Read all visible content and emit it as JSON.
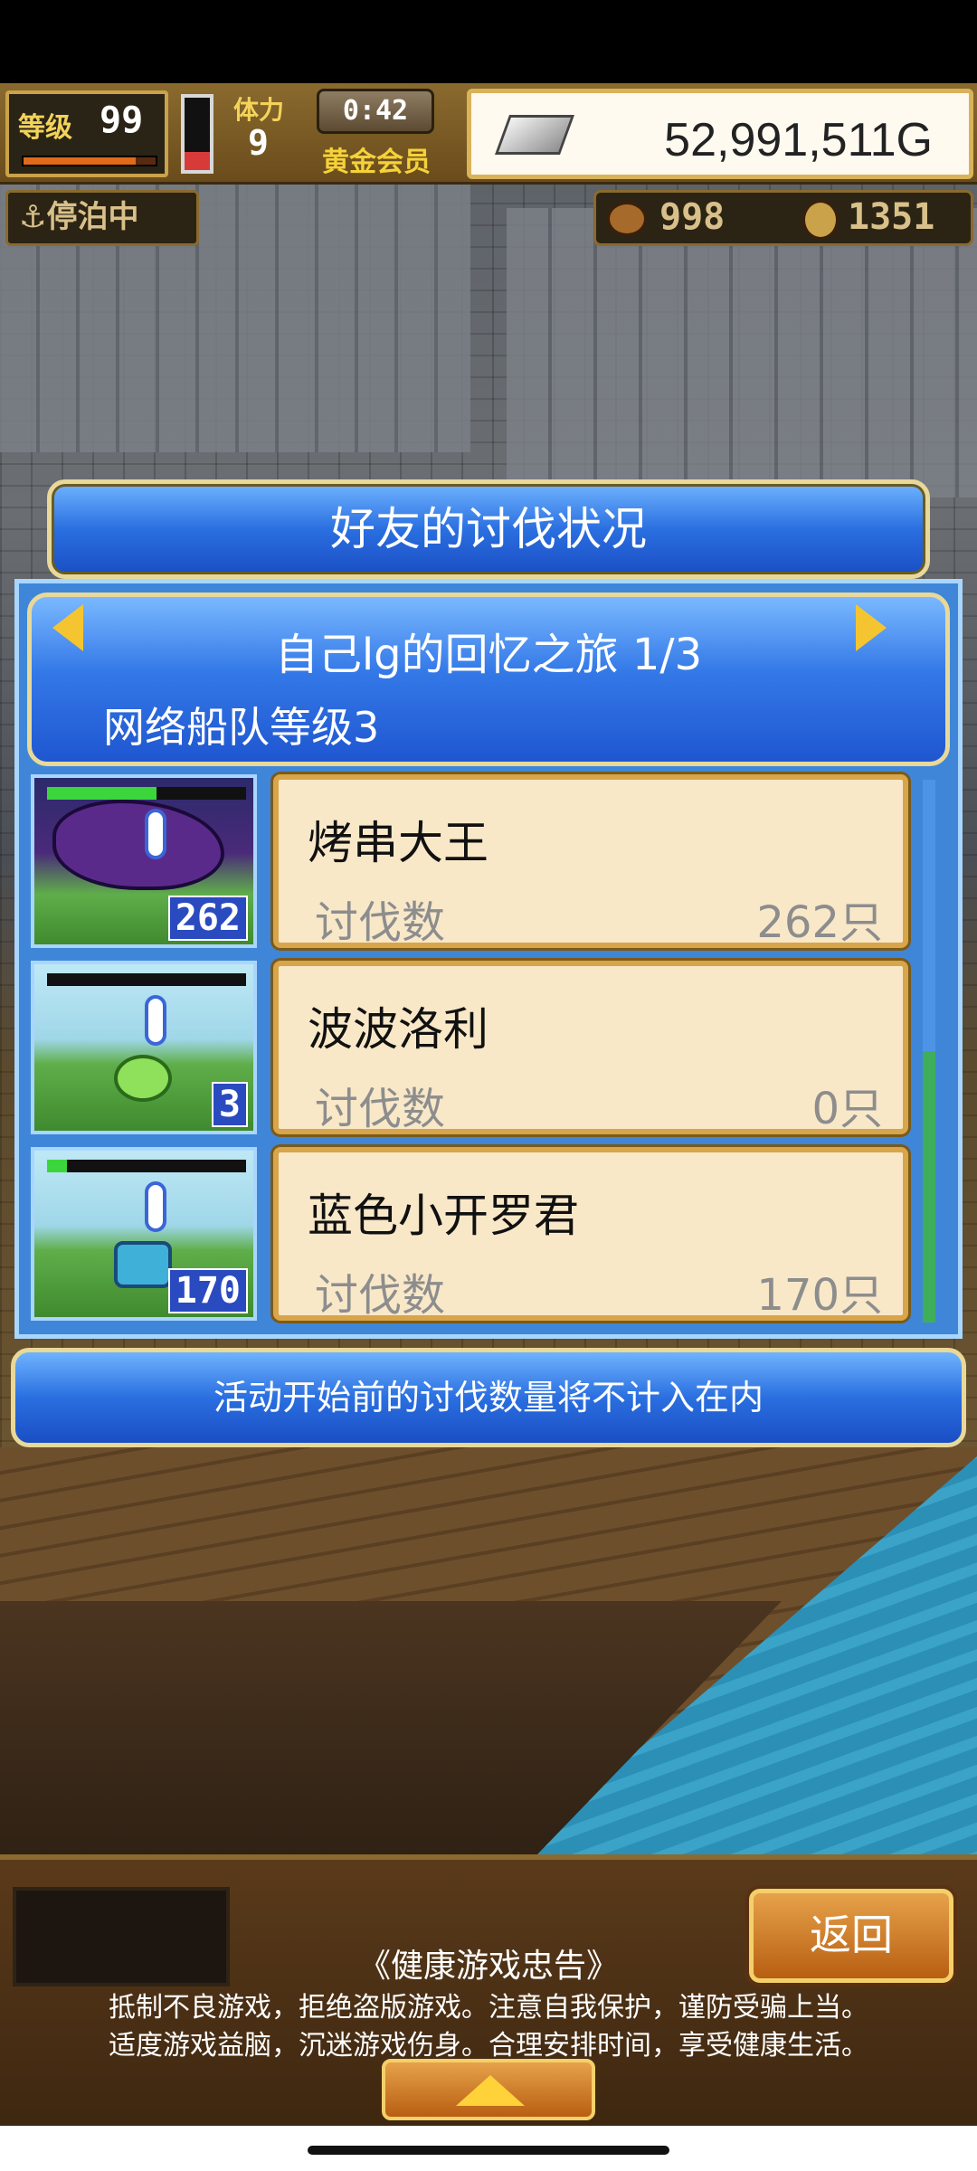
{
  "hud": {
    "level_label": "等级",
    "level_value": "99",
    "level_progress": 0.85,
    "stamina_label": "体力",
    "stamina_value": "9",
    "stamina_fill": 0.25,
    "timer": "0:42",
    "membership": "黄金会员",
    "gold": "52,991,511G",
    "dock_status": "停泊中",
    "resource1": "998",
    "resource2": "1351"
  },
  "dialog": {
    "title": "好友的讨伐状况",
    "event_title": "自己lg的回忆之旅 1/3",
    "event_subtitle": "网络船队等级3",
    "rows": [
      {
        "name": "烤串大王",
        "label": "讨伐数",
        "value": "262只",
        "thumb_count": "262",
        "hp": 0.55
      },
      {
        "name": "波波洛利",
        "label": "讨伐数",
        "value": "0只",
        "thumb_count": "3",
        "hp": 0.0
      },
      {
        "name": "蓝色小开罗君",
        "label": "讨伐数",
        "value": "170只",
        "thumb_count": "170",
        "hp": 0.1
      }
    ],
    "notice": "活动开始前的讨伐数量将不计入在内"
  },
  "bottom": {
    "back_label": "返回",
    "advice_title": "《健康游戏忠告》",
    "advice_line1": "抵制不良游戏，拒绝盗版游戏。注意自我保护，谨防受骗上当。",
    "advice_line2": "适度游戏益脑，沉迷游戏伤身。合理安排时间，享受健康生活。"
  },
  "colors": {
    "accent_blue": "#2a6fe0",
    "card_bg": "#f8e8c8",
    "gold_text": "#f5d23a"
  }
}
